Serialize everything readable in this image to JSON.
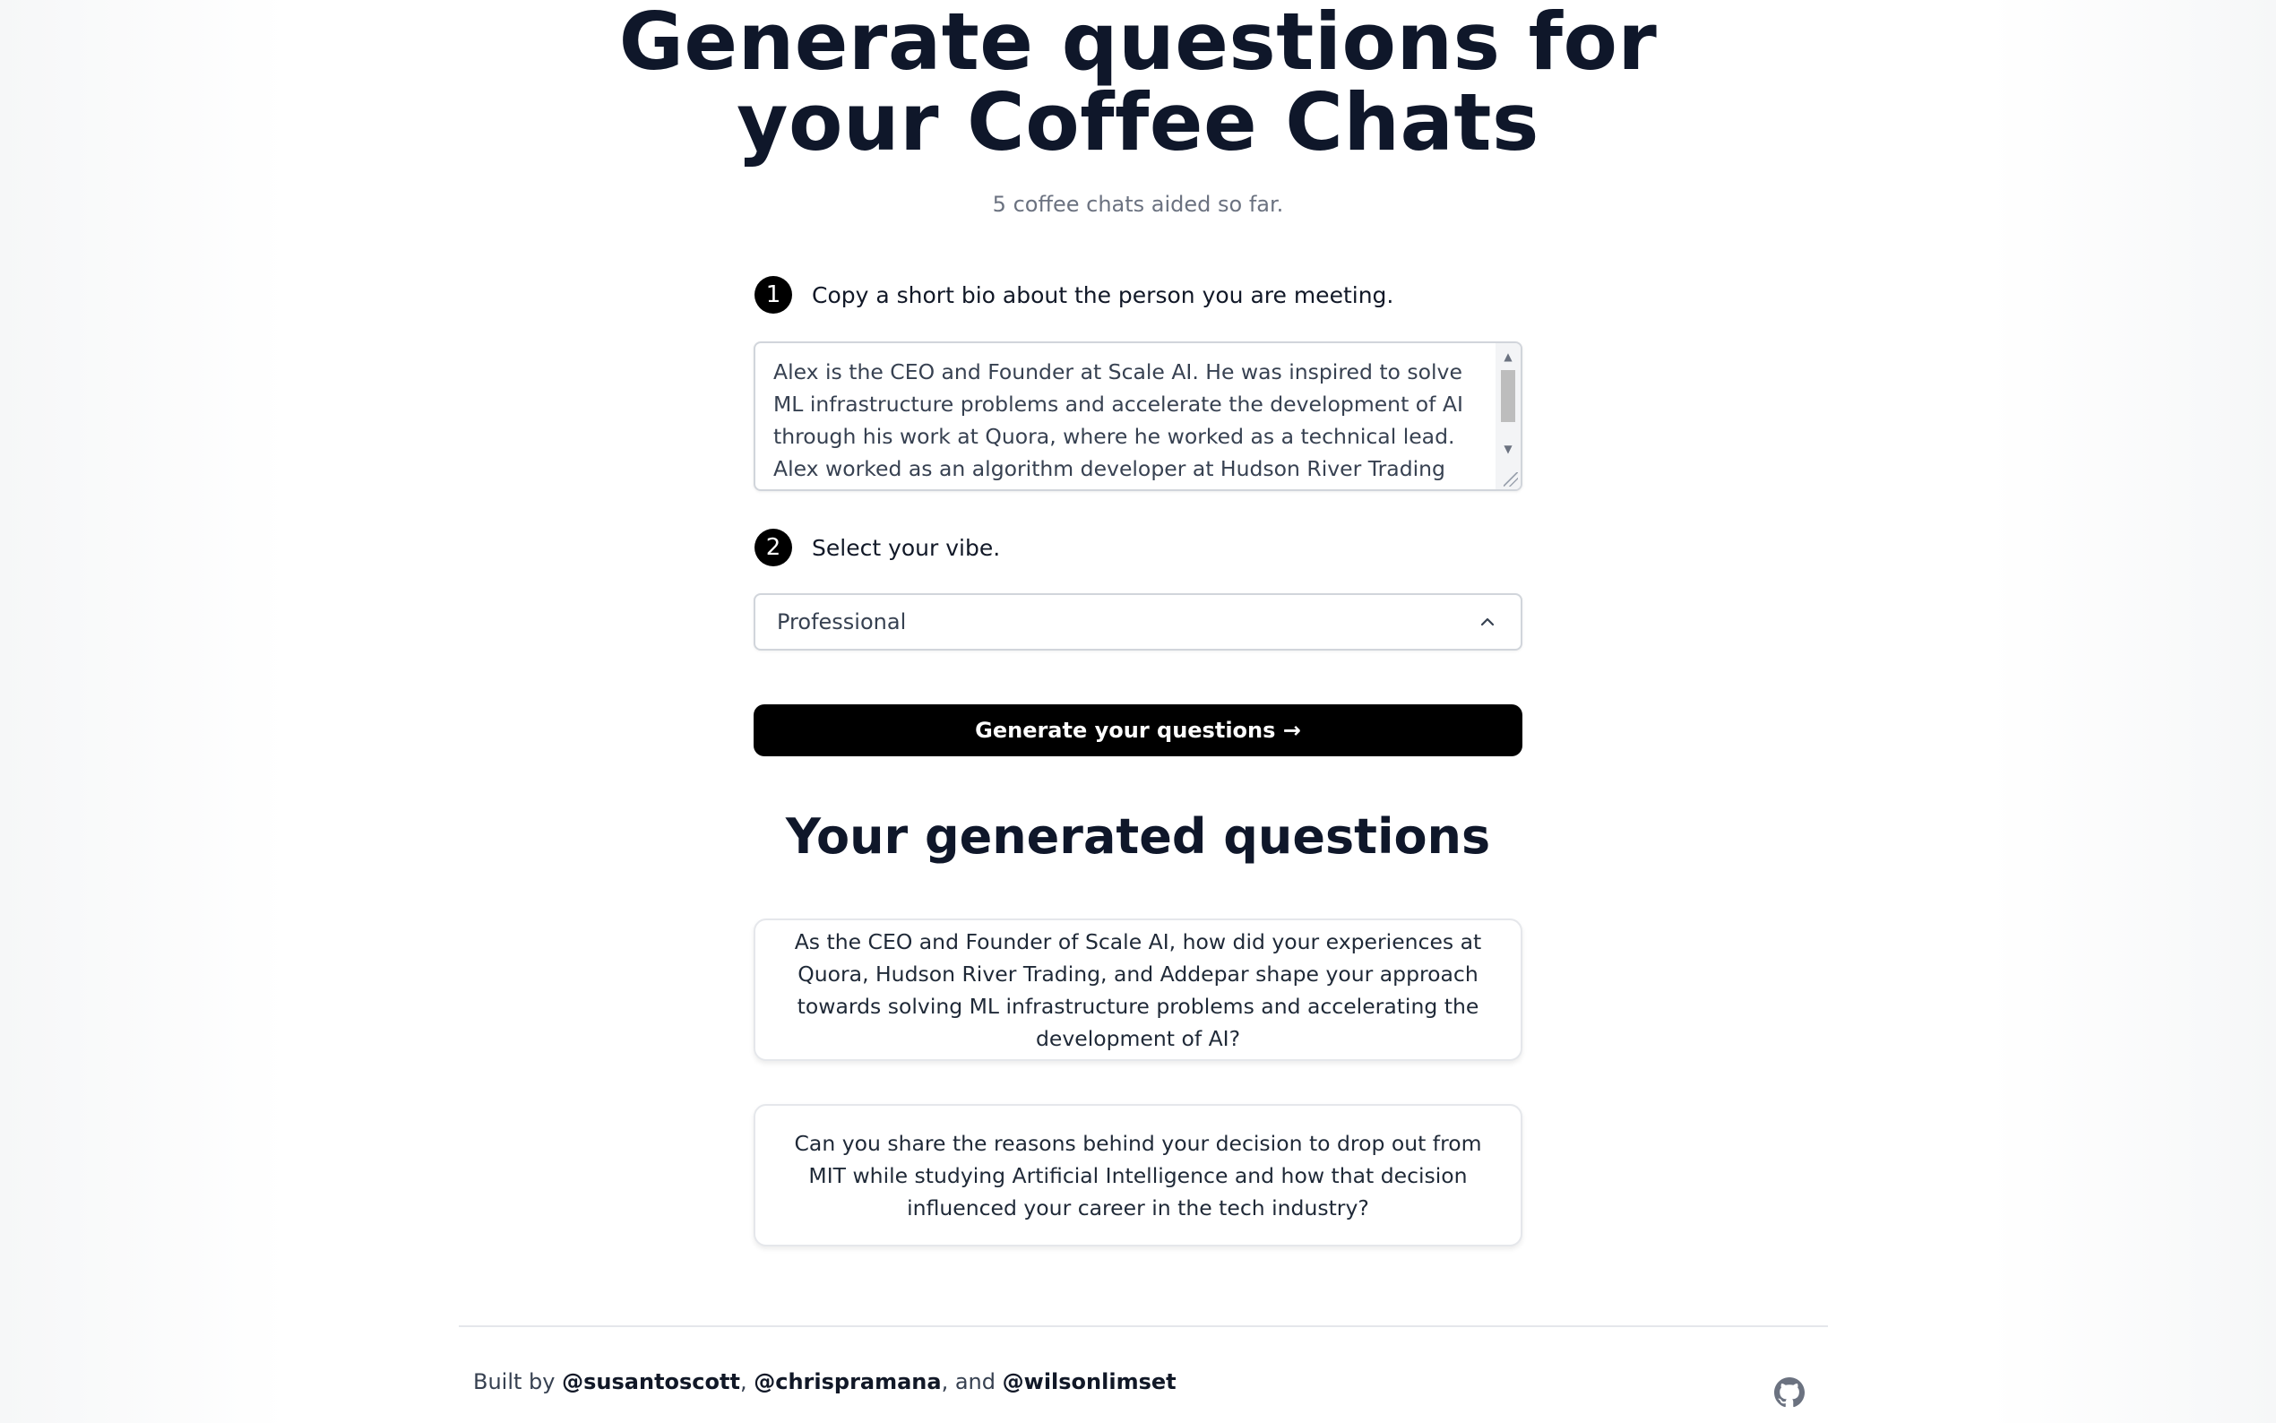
{
  "hero": {
    "title_line1": "Generate questions for",
    "title_line2": "your Coffee Chats",
    "subtitle": "5 coffee chats aided so far."
  },
  "steps": [
    {
      "number": "1",
      "label": "Copy a short bio about the person you are meeting."
    },
    {
      "number": "2",
      "label": "Select your vibe."
    }
  ],
  "bio": {
    "value": "Alex is the CEO and Founder at Scale AI. He was inspired to solve ML infrastructure problems and accelerate the development of AI through his work at Quora, where he worked as a technical lead. Alex worked as an algorithm developer at Hudson River Trading and as a software engineer at Addepar."
  },
  "vibe": {
    "selected": "Professional"
  },
  "generate_button": {
    "label": "Generate your questions →"
  },
  "results": {
    "title": "Your generated questions",
    "questions": [
      "As the CEO and Founder of Scale AI, how did your experiences at Quora, Hudson River Trading, and Addepar shape your approach towards solving ML infrastructure problems and accelerating the development of AI?",
      "Can you share the reasons behind your decision to drop out from MIT while studying Artificial Intelligence and how that decision influenced your career in the tech industry?"
    ]
  },
  "footer": {
    "built_by": "Built by ",
    "author1": "@susantoscott",
    "sep1": ", ",
    "author2": "@chrispramana",
    "sep2": ", and ",
    "author3": "@wilsonlimset"
  },
  "icons": {
    "github": "github-icon",
    "chevron": "chevron-up-icon"
  }
}
